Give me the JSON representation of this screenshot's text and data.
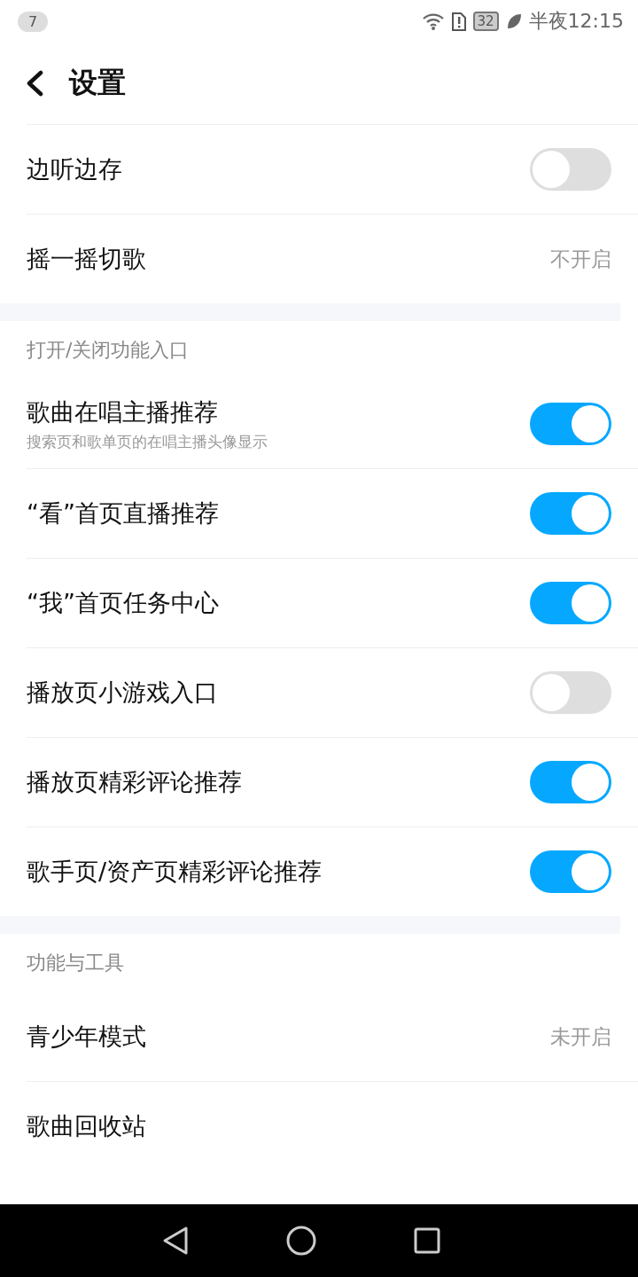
{
  "status_bar": {
    "notification_count": "7",
    "battery": "32",
    "time": "半夜12:15"
  },
  "header": {
    "title": "设置"
  },
  "sections": [
    {
      "items": [
        {
          "kind": "toggle",
          "label": "边听边存",
          "on": false
        },
        {
          "kind": "value",
          "label": "摇一摇切歌",
          "value": "不开启"
        }
      ]
    },
    {
      "title": "打开/关闭功能入口",
      "items": [
        {
          "kind": "toggle",
          "label": "歌曲在唱主播推荐",
          "subtitle": "搜索页和歌单页的在唱主播头像显示",
          "on": true
        },
        {
          "kind": "toggle",
          "label": "“看”首页直播推荐",
          "on": true
        },
        {
          "kind": "toggle",
          "label": "“我”首页任务中心",
          "on": true
        },
        {
          "kind": "toggle",
          "label": "播放页小游戏入口",
          "on": false
        },
        {
          "kind": "toggle",
          "label": "播放页精彩评论推荐",
          "on": true
        },
        {
          "kind": "toggle",
          "label": "歌手页/资产页精彩评论推荐",
          "on": true
        }
      ]
    },
    {
      "title": "功能与工具",
      "items": [
        {
          "kind": "value",
          "label": "青少年模式",
          "value": "未开启"
        },
        {
          "kind": "link",
          "label": "歌曲回收站"
        }
      ]
    }
  ]
}
